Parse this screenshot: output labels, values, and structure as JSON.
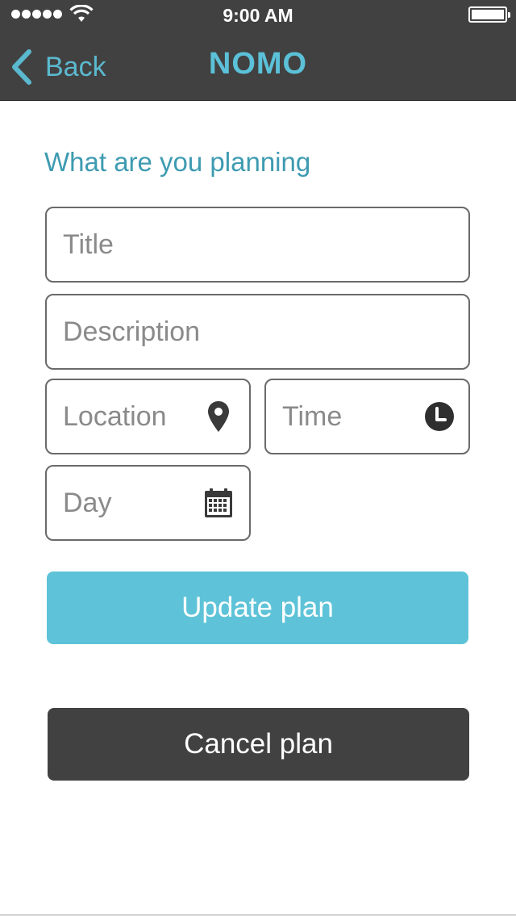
{
  "status_bar": {
    "time": "9:00 AM",
    "signal_icon": "signal-dots-icon",
    "wifi_icon": "wifi-icon",
    "battery_icon": "battery-icon"
  },
  "nav": {
    "back_label": "Back",
    "back_icon": "chevron-left-icon",
    "title": "NOMO"
  },
  "form": {
    "heading": "What are you planning",
    "title_placeholder": "Title",
    "description_placeholder": "Description",
    "location_placeholder": "Location",
    "location_icon": "map-pin-icon",
    "time_placeholder": "Time",
    "time_icon": "clock-icon",
    "day_placeholder": "Day",
    "day_icon": "calendar-icon"
  },
  "actions": {
    "update_label": "Update plan",
    "cancel_label": "Cancel plan"
  },
  "colors": {
    "nav_bg": "#414141",
    "accent": "#5ec3d8",
    "heading": "#3e9bb1",
    "cancel_bg": "#414141"
  }
}
